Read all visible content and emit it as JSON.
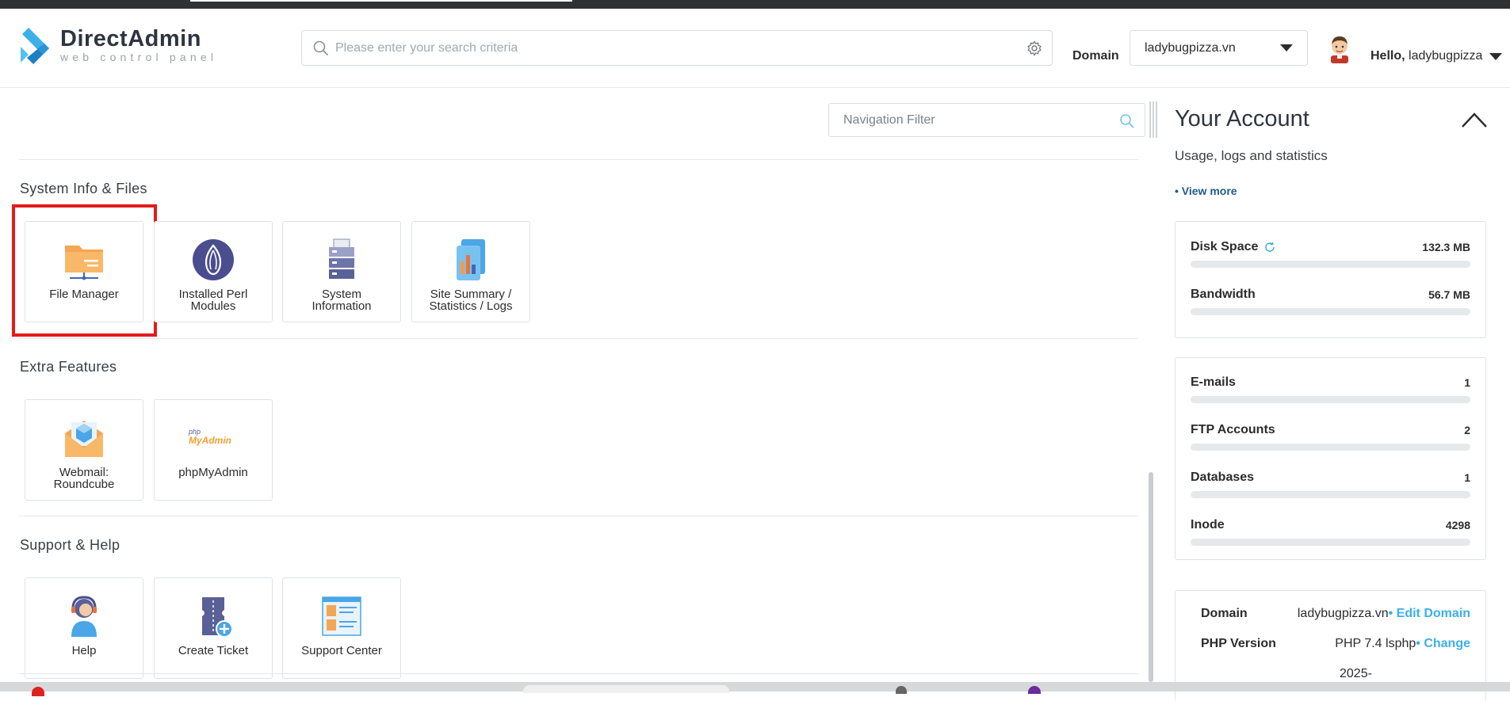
{
  "header": {
    "logo_name": "DirectAdmin",
    "logo_sub": "web control panel",
    "search_placeholder": "Please enter your search criteria",
    "domain_label": "Domain",
    "domain_value": "ladybugpizza.vn",
    "hello_prefix": "Hello,",
    "username": "ladybugpizza"
  },
  "nav_filter": {
    "placeholder": "Navigation Filter"
  },
  "sections": [
    {
      "title": "System Info & Files",
      "tiles": [
        {
          "label": "File Manager",
          "icon": "folder-icon"
        },
        {
          "label": "Installed Perl Modules",
          "icon": "perl-onion-icon"
        },
        {
          "label": "System Information",
          "icon": "server-icon"
        },
        {
          "label": "Site Summary / Statistics / Logs",
          "icon": "statistics-icon"
        }
      ]
    },
    {
      "title": "Extra Features",
      "tiles": [
        {
          "label": "Webmail: Roundcube",
          "icon": "webmail-icon"
        },
        {
          "label": "phpMyAdmin",
          "icon": "phpmyadmin-logo"
        }
      ]
    },
    {
      "title": "Support & Help",
      "tiles": [
        {
          "label": "Help",
          "icon": "help-agent-icon"
        },
        {
          "label": "Create Ticket",
          "icon": "ticket-icon"
        },
        {
          "label": "Support Center",
          "icon": "support-center-icon"
        }
      ]
    }
  ],
  "phpmyadmin_logo": {
    "php": "php",
    "myadmin": "MyAdmin"
  },
  "account": {
    "title": "Your Account",
    "subtitle": "Usage, logs and statistics",
    "view_more": "• View more",
    "usage": [
      {
        "label": "Disk Space",
        "value": "132.3 MB",
        "fill": 0
      },
      {
        "label": "Bandwidth",
        "value": "56.7 MB",
        "fill": 0
      }
    ],
    "counts": [
      {
        "label": "E-mails",
        "value": "1",
        "fill": 0
      },
      {
        "label": "FTP Accounts",
        "value": "2",
        "fill": 0
      },
      {
        "label": "Databases",
        "value": "1",
        "fill": 0
      },
      {
        "label": "Inode",
        "value": "4298",
        "fill": 0
      }
    ],
    "info": {
      "domain_label": "Domain",
      "domain_value": "ladybugpizza.vn",
      "domain_link": "• Edit Domain",
      "php_label": "PHP Version",
      "php_value": "PHP 7.4 lsphp",
      "php_link": "• Change",
      "date_partial": "2025-"
    }
  },
  "colors": {
    "accent": "#3cb0e8",
    "highlight": "#e31b1b",
    "link": "#1f5c8a"
  }
}
